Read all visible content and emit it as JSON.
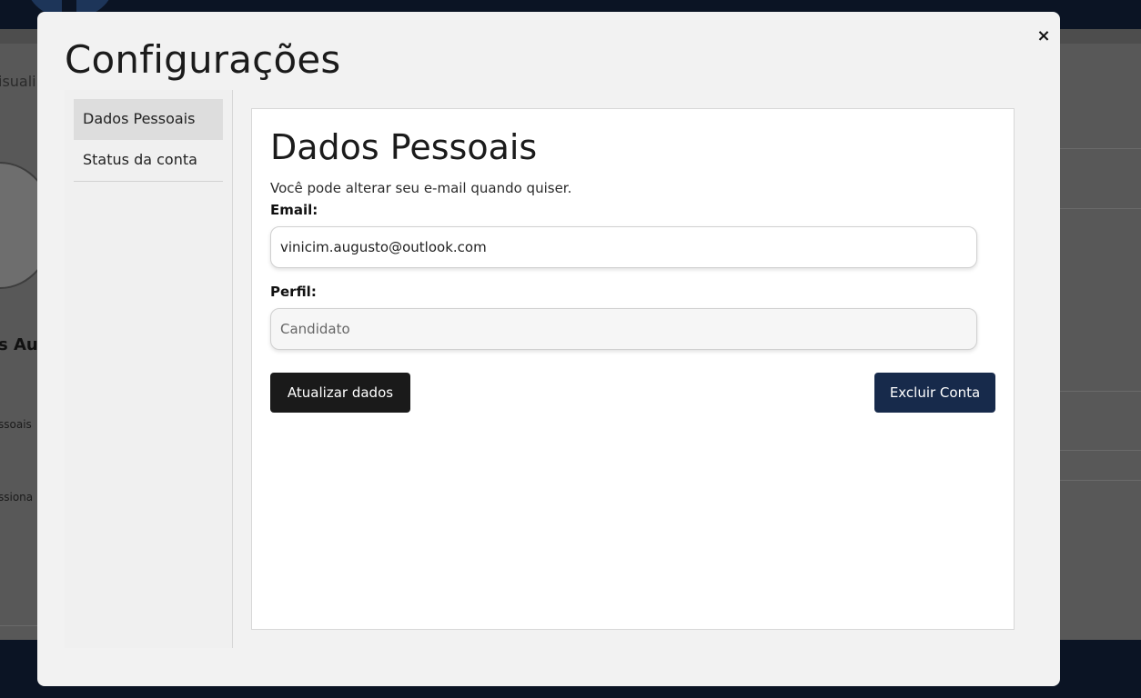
{
  "background": {
    "fragment_1": "isuali",
    "fragment_2": "s Au",
    "fragment_3": "ssoais",
    "fragment_4": "ssiona"
  },
  "modal": {
    "title": "Configurações",
    "close_icon": "×",
    "sidebar": {
      "items": [
        {
          "label": "Dados Pessoais",
          "active": true
        },
        {
          "label": "Status da conta",
          "active": false
        }
      ]
    },
    "panel": {
      "title": "Dados Pessoais",
      "description": "Você pode alterar seu e-mail quando quiser.",
      "email_label": "Email:",
      "email_value": "vinicim.augusto@outlook.com",
      "perfil_label": "Perfil:",
      "perfil_value": "Candidato",
      "update_button": "Atualizar dados",
      "delete_button": "Excluir Conta"
    }
  },
  "colors": {
    "topbar": "#0b1424",
    "overlay_page": "#585858",
    "modal_bg": "#f2f2f2",
    "update_button": "#1a1a1a",
    "delete_button": "#172a4b"
  }
}
